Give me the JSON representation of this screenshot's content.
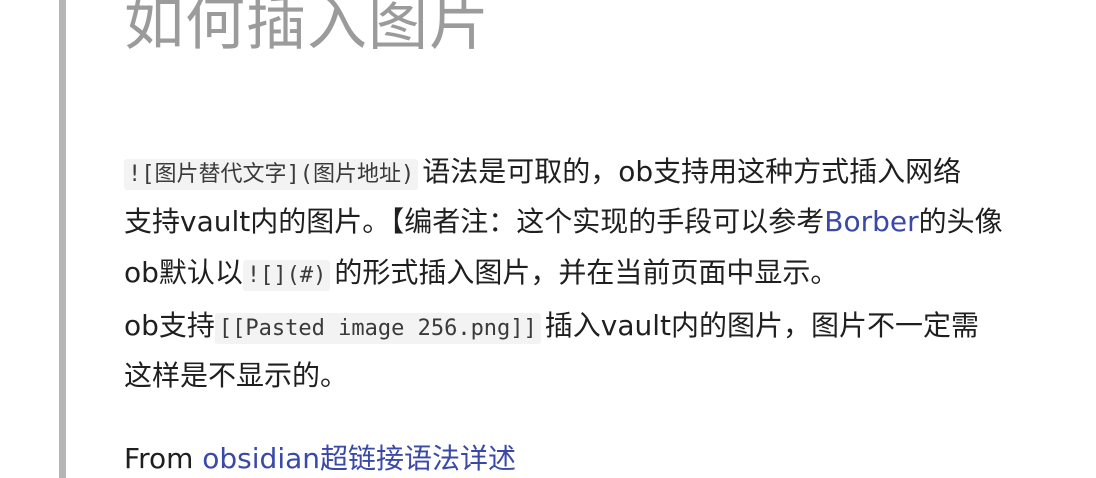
{
  "heading": "如何插入图片",
  "para1": {
    "code": "![图片替代文字](图片地址)",
    "text": "语法是可取的，ob支持用这种方式插入网络"
  },
  "para2": {
    "text_before": "支持vault内的图片。【编者注：这个实现的手段可以参考",
    "link": "Borber",
    "text_after": "的头像"
  },
  "para3": {
    "text_before": "ob默认以",
    "code": "![](#)",
    "text_after": "的形式插入图片，并在当前页面中显示。"
  },
  "para4": {
    "text_before": "ob支持",
    "code": "[[Pasted image 256.png]]",
    "text_after": "插入vault内的图片，图片不一定需"
  },
  "para5": {
    "text": "这样是不显示的。"
  },
  "source": {
    "prefix": "From ",
    "link": "obsidian超链接语法详述"
  },
  "colors": {
    "link": "#3a49a8",
    "heading": "#9b9b9b",
    "quote_bar": "#b5b5b5",
    "code_bg": "#f3f3f3"
  }
}
